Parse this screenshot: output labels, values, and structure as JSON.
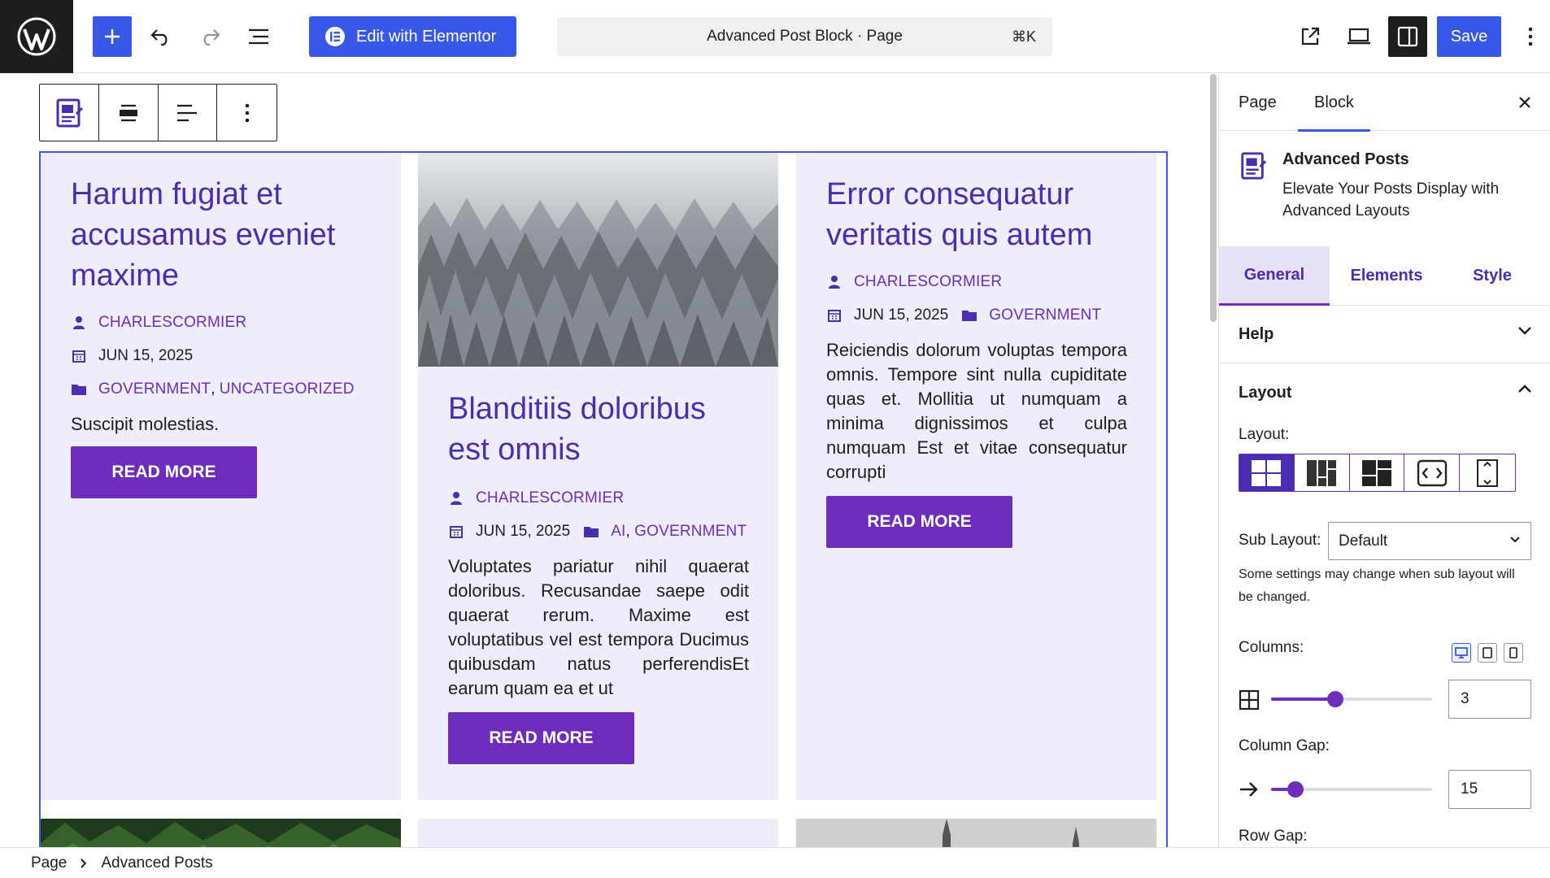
{
  "topbar": {
    "elementor_label": "Edit with Elementor",
    "document_title": "Advanced Post Block · Page",
    "shortcut": "⌘K",
    "save_label": "Save"
  },
  "posts": [
    {
      "title": "Harum fugiat et accusamus eveniet maxime",
      "author": "CHARLESCORMIER",
      "date": "JUN 15, 2025",
      "categories": [
        "GOVERNMENT",
        "UNCATEGORIZED"
      ],
      "excerpt": "Suscipit molestias.",
      "button": "READ MORE",
      "image": null
    },
    {
      "title": "Blanditiis doloribus est omnis",
      "author": "CHARLESCORMIER",
      "date": "JUN 15, 2025",
      "categories": [
        "AI",
        "GOVERNMENT"
      ],
      "excerpt": "Voluptates pariatur nihil quaerat doloribus. Recusandae saepe odit quaerat rerum. Maxime est voluptatibus vel est tempora Ducimus quibusdam natus perferendisEt earum quam ea et ut",
      "button": "READ MORE",
      "image": "snowy-forest"
    },
    {
      "title": "Error consequatur veritatis quis autem",
      "author": "CHARLESCORMIER",
      "date": "JUN 15, 2025",
      "categories": [
        "GOVERNMENT"
      ],
      "excerpt": "Reiciendis dolorum voluptas tempora omnis. Tempore sint nulla cupiditate quas et. Mollitia ut numquam a minima dignissimos et culpa numquam Est et vitae consequatur corrupti",
      "button": "READ MORE",
      "image": null
    }
  ],
  "sidebar": {
    "tabs": [
      "Page",
      "Block"
    ],
    "active_tab": "Block",
    "block_name": "Advanced Posts",
    "block_description": "Elevate Your Posts Display with Advanced Layouts",
    "inner_tabs": [
      "General",
      "Elements",
      "Style"
    ],
    "active_inner_tab": "General",
    "help_label": "Help",
    "layout_section": "Layout",
    "layout_label": "Layout:",
    "sub_layout_label": "Sub Layout:",
    "sub_layout_value": "Default",
    "sub_layout_help": "Some settings may change when sub layout will be changed.",
    "columns_label": "Columns:",
    "columns_value": "3",
    "columns_range": [
      1,
      6
    ],
    "column_gap_label": "Column Gap:",
    "column_gap_value": "15",
    "column_gap_range": [
      0,
      100
    ],
    "row_gap_label": "Row Gap:"
  },
  "breadcrumb": [
    "Page",
    "Advanced Posts"
  ],
  "colors": {
    "accent": "#3858e9",
    "brand_purple": "#6f2dbd",
    "title_purple": "#4a2db1",
    "card_bg": "#efecfb"
  }
}
